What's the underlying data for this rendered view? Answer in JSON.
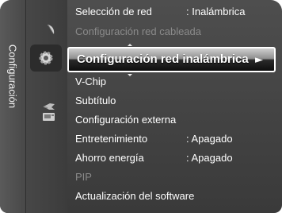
{
  "sidebar": {
    "title": "Configuración",
    "icons": [
      "satellite-dish-icon",
      "settings-gear-icon",
      "input-plug-icon",
      "application-icon"
    ]
  },
  "menu": {
    "network_selection": {
      "label": "Selección de red",
      "value": ": Inalámbrica"
    },
    "wired_config": {
      "label": "Configuración red cableada"
    },
    "wireless_config": {
      "label": "Configuración red inalámbrica",
      "arrow": "►"
    },
    "vchip": {
      "label": "V-Chip"
    },
    "subtitle": {
      "label": "Subtítulo"
    },
    "external_config": {
      "label": "Configuración externa"
    },
    "entertainment": {
      "label": "Entretenimiento",
      "value": ": Apagado"
    },
    "energy_saving": {
      "label": "Ahorro energía",
      "value": ": Apagado"
    },
    "pip": {
      "label": "PIP"
    },
    "software_update": {
      "label": "Actualización del software"
    }
  },
  "colors": {
    "panel": "#3a3a3a",
    "text": "#ffffff",
    "disabled_text": "#8a8a8a",
    "highlight_border": "#ffffff"
  }
}
